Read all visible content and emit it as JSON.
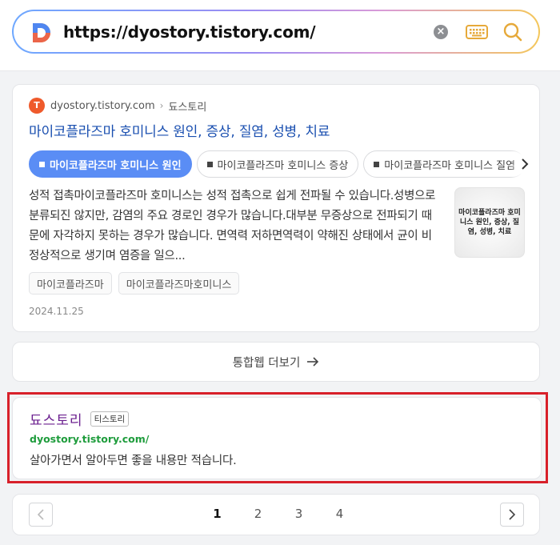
{
  "search": {
    "url": "https://dyostory.tistory.com/"
  },
  "result": {
    "favicon_glyph": "T",
    "source_domain": "dyostory.tistory.com",
    "separator": "›",
    "source_name": "됴스토리",
    "title": "마이코플라즈마 호미니스 원인, 증상, 질염, 성병, 치료",
    "chips": [
      {
        "label": "마이코플라즈마 호미니스 원인",
        "active": true
      },
      {
        "label": "마이코플라즈마 호미니스 증상",
        "active": false
      },
      {
        "label": "마이코플라즈마 호미니스 질염",
        "active": false
      }
    ],
    "snippet": "성적 접촉마이코플라즈마 호미니스는 성적 접촉으로 쉽게 전파될 수 있습니다.성병으로 분류되진 않지만, 감염의 주요 경로인 경우가 많습니다.대부분 무증상으로 전파되기 때문에 자각하지 못하는 경우가 많습니다. 면역력 저하면역력이 약해진 상태에서 균이 비정상적으로 생기며 염증을 일으...",
    "thumbnail_text": "마이코플라즈마 호미니스 원인, 증상, 질염, 성병, 치료",
    "tags": [
      "마이코플라즈마",
      "마이코플라즈마호미니스"
    ],
    "date": "2024.11.25"
  },
  "more": {
    "label": "통합웹 더보기"
  },
  "site": {
    "name": "됴스토리",
    "badge": "티스토리",
    "url": "dyostory.tistory.com/",
    "description": "살아가면서 알아두면 좋을 내용만 적습니다."
  },
  "pagination": {
    "pages": [
      "1",
      "2",
      "3",
      "4"
    ],
    "current": "1"
  },
  "colors": {
    "accent": "#5a8df5",
    "title_link": "#1a4fb0",
    "site_url": "#1e9c3c",
    "site_name": "#6b1f8f",
    "highlight": "#d8202a"
  }
}
